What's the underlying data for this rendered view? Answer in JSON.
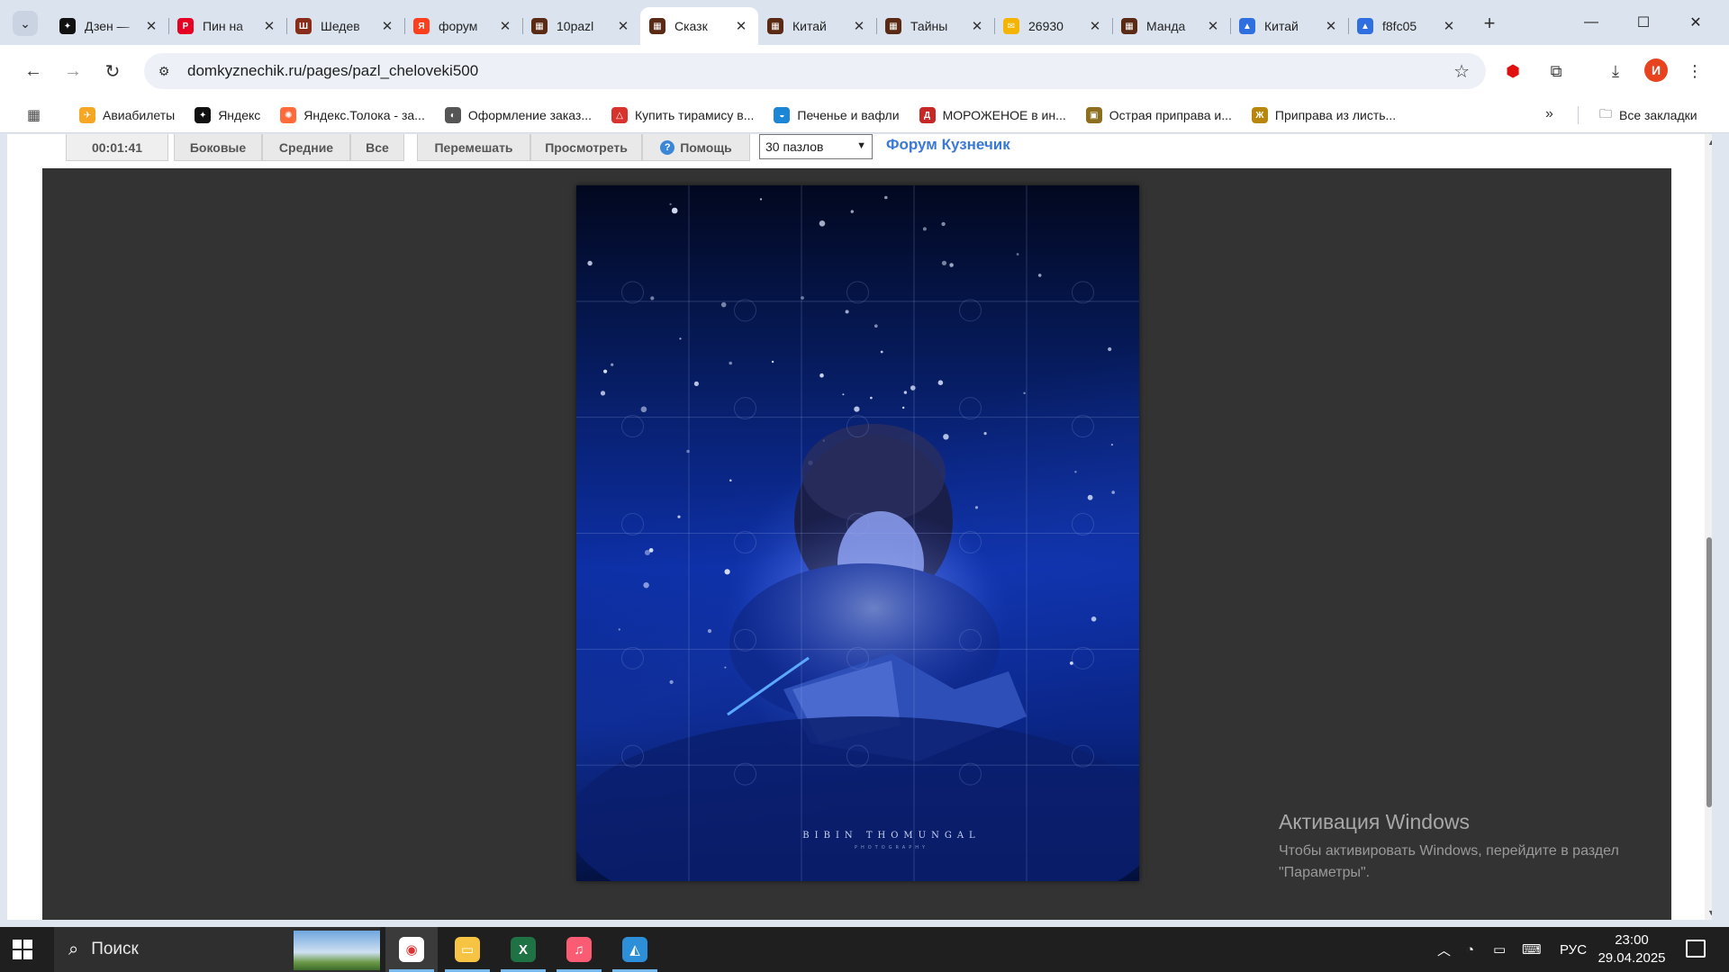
{
  "browser": {
    "tabs": [
      {
        "title": "Дзен — ",
        "favicon": "dzen-icon",
        "color": "#111111",
        "glyph": "✦"
      },
      {
        "title": "Пин на",
        "favicon": "pinterest-icon",
        "color": "#e60023",
        "glyph": "P"
      },
      {
        "title": "Шедев",
        "favicon": "site-icon",
        "color": "#8a2c1a",
        "glyph": "Ш"
      },
      {
        "title": "форум",
        "favicon": "yandex-icon",
        "color": "#fc3f1d",
        "glyph": "Я"
      },
      {
        "title": "10pazl",
        "favicon": "site-icon",
        "color": "#5a2a14",
        "glyph": "▦"
      },
      {
        "title": "Сказк",
        "favicon": "site-icon",
        "color": "#5a2a14",
        "glyph": "▦",
        "active": true
      },
      {
        "title": "Китай",
        "favicon": "site-icon",
        "color": "#5a2a14",
        "glyph": "▦"
      },
      {
        "title": "Тайны",
        "favicon": "site-icon",
        "color": "#5a2a14",
        "glyph": "▦"
      },
      {
        "title": "26930",
        "favicon": "mail-icon",
        "color": "#f4b400",
        "glyph": "✉"
      },
      {
        "title": "Манда",
        "favicon": "site-icon",
        "color": "#5a2a14",
        "glyph": "▦"
      },
      {
        "title": "Китай",
        "favicon": "image-icon",
        "color": "#2f6fe0",
        "glyph": "▲"
      },
      {
        "title": "f8fc05",
        "favicon": "image-icon",
        "color": "#2f6fe0",
        "glyph": "▲"
      }
    ],
    "url": "domkyznechik.ru/pages/pazl_cheloveki500",
    "avatar_letter": "И",
    "bookmarks": [
      {
        "label": "Авиабилеты",
        "color": "#f5a623",
        "glyph": "✈"
      },
      {
        "label": "Яндекс",
        "color": "#111111",
        "glyph": "✦"
      },
      {
        "label": "Яндекс.Толока - за...",
        "color": "#ff6a3d",
        "glyph": "✺"
      },
      {
        "label": "Оформление заказ...",
        "color": "#555555",
        "glyph": "◐"
      },
      {
        "label": "Купить тирамису в...",
        "color": "#d9322b",
        "glyph": "△"
      },
      {
        "label": "Печенье и вафли",
        "color": "#1b86d6",
        "glyph": "◒"
      },
      {
        "label": "МОРОЖЕНОЕ в ин...",
        "color": "#c62828",
        "glyph": "Д"
      },
      {
        "label": "Острая приправа и...",
        "color": "#8d6e1f",
        "glyph": "▣"
      },
      {
        "label": "Приправа из листь...",
        "color": "#b8860b",
        "glyph": "Ж"
      }
    ],
    "all_bookmarks": "Все закладки"
  },
  "game": {
    "timer": "00:01:41",
    "filters": [
      "Боковые",
      "Средние",
      "Все"
    ],
    "actions": [
      "Перемешать",
      "Просмотреть"
    ],
    "help": "Помощь",
    "pieces_select": "30 пазлов",
    "forum_link": "Форум Кузнечик",
    "puzzle": {
      "cols": 5,
      "rows": 6,
      "credit": "BIBIN THOMUNGAL",
      "credit_sub": "PHOTOGRAPHY"
    }
  },
  "watermark": {
    "title": "Активация Windows",
    "text": "Чтобы активировать Windows, перейдите в раздел \"Параметры\"."
  },
  "taskbar": {
    "search_label": "Поиск",
    "apps": [
      {
        "name": "chrome-icon",
        "color": "#ffffff",
        "glyph": "◉",
        "active": true
      },
      {
        "name": "file-explorer-icon",
        "color": "#f6c343",
        "glyph": "▭"
      },
      {
        "name": "excel-icon",
        "color": "#1f7244",
        "glyph": "X"
      },
      {
        "name": "itunes-icon",
        "color": "#fb5c74",
        "glyph": "♫"
      },
      {
        "name": "paint-icon",
        "color": "#2d8fd8",
        "glyph": "◭"
      }
    ],
    "language": "РУС",
    "time": "23:00",
    "date": "29.04.2025"
  }
}
